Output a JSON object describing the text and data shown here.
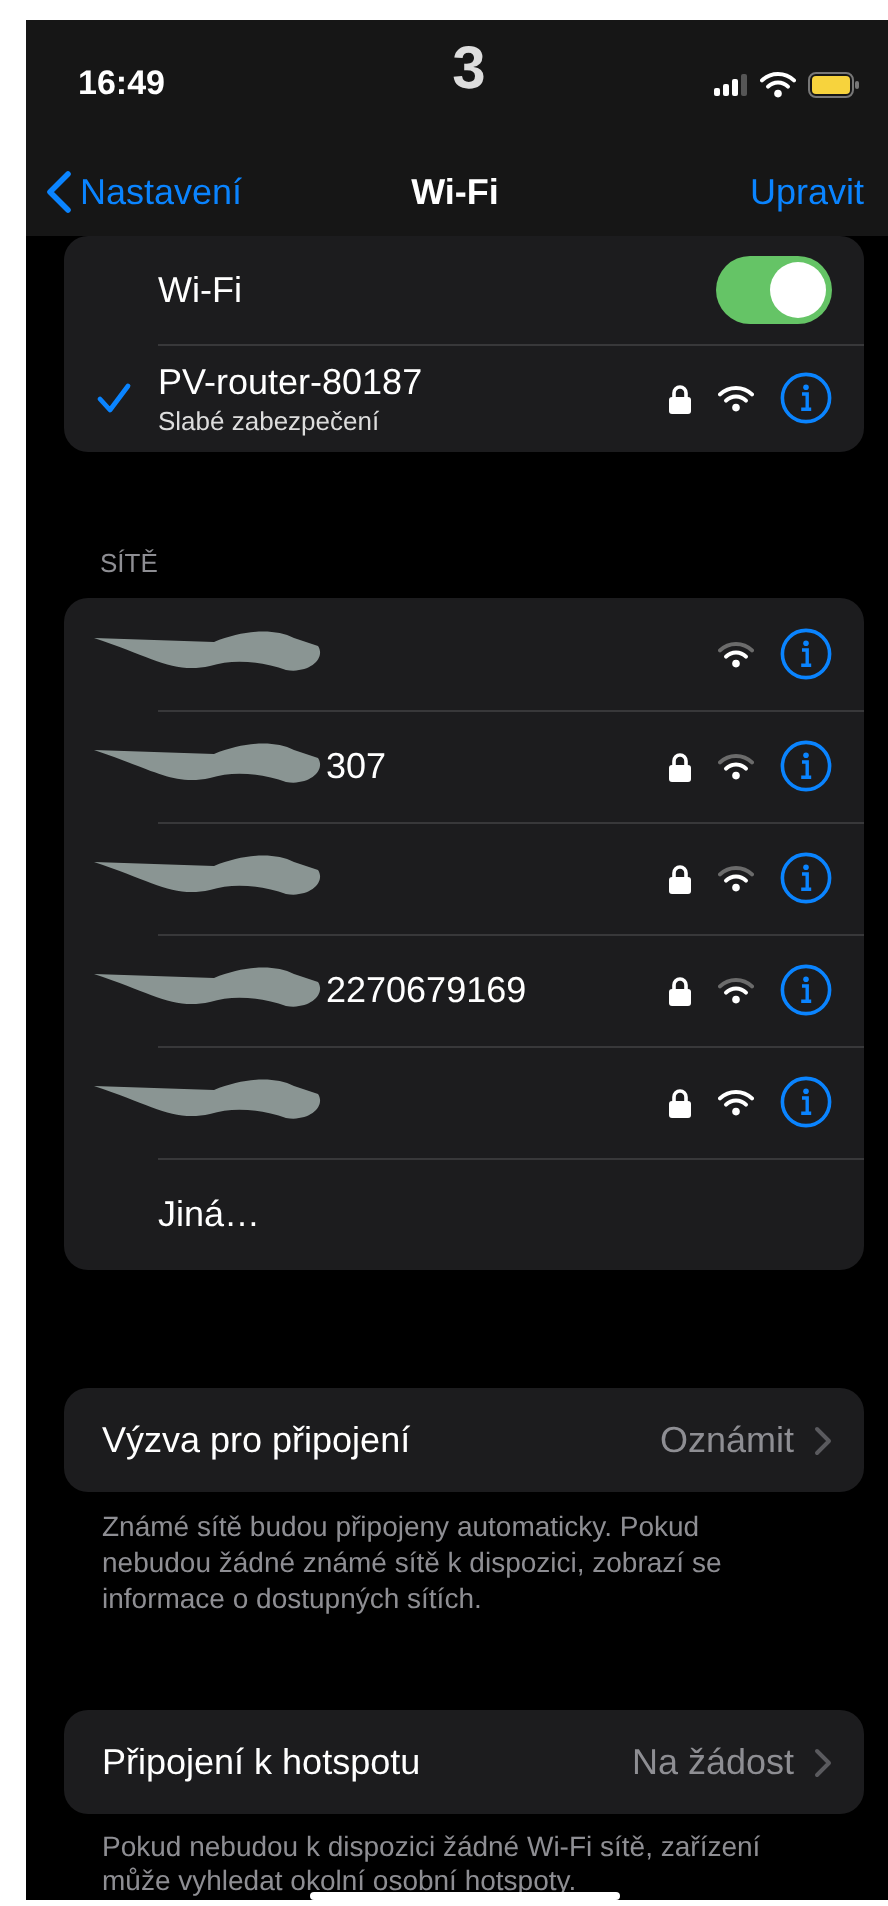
{
  "status_bar": {
    "time": "16:49",
    "badge": "3"
  },
  "nav": {
    "back": "Nastavení",
    "title": "Wi-Fi",
    "action": "Upravit"
  },
  "wifi": {
    "label": "Wi-Fi",
    "on": true
  },
  "current": {
    "name": "PV-router-80187",
    "subtitle": "Slabé zabezpečení",
    "selected": true,
    "secured": true,
    "strong": true
  },
  "networks_header": "SÍTĚ",
  "networks": [
    {
      "kind": "network",
      "redacted": true,
      "secured": false,
      "strong": false
    },
    {
      "kind": "network",
      "name": "307",
      "redacted": true,
      "secured": true,
      "strong": false
    },
    {
      "kind": "network",
      "redacted": true,
      "secured": true,
      "strong": false
    },
    {
      "kind": "network",
      "name": "2270679169",
      "redacted": true,
      "secured": true,
      "strong": false
    },
    {
      "kind": "network",
      "redacted": true,
      "secured": true,
      "strong": true
    },
    {
      "kind": "other",
      "name": "Jiná…"
    }
  ],
  "settings": [
    {
      "label": "Výzva pro připojení",
      "value": "Oznámit",
      "footer": "Známé sítě budou připojeny automaticky. Pokud nebudou žádné známé sítě k dispozici, zobrazí se informace o dostupných sítích."
    },
    {
      "label": "Připojení k hotspotu",
      "value": "Na žádost",
      "footer": "Pokud nebudou k dispozici žádné Wi-Fi sítě, zařízení může vyhledat okolní osobní hotspoty."
    }
  ]
}
